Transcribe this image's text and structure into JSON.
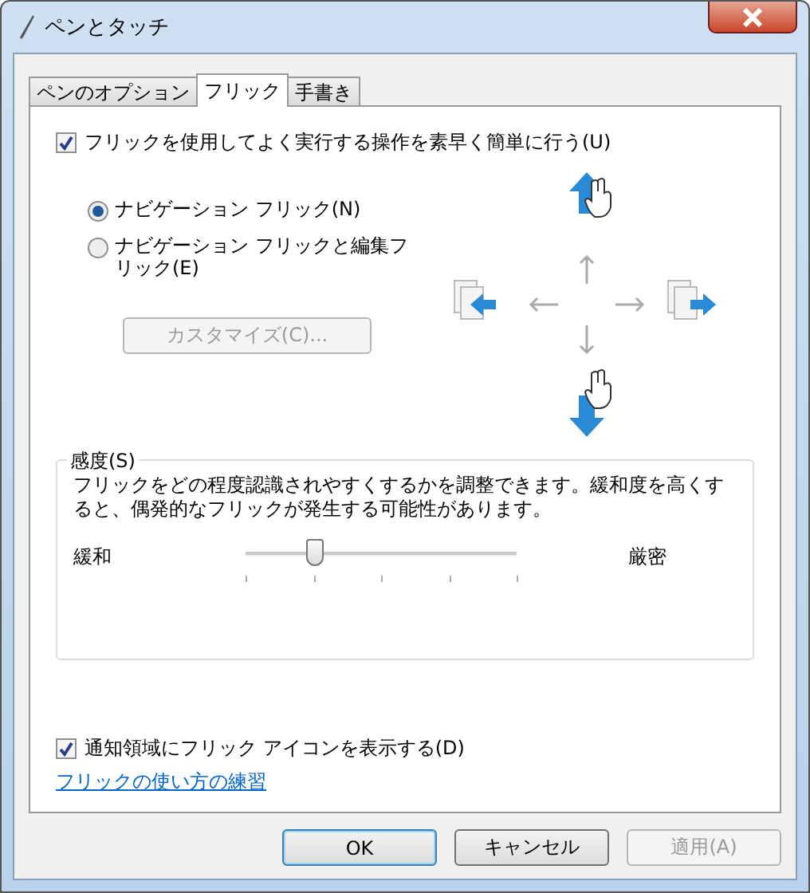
{
  "window": {
    "title": "ペンとタッチ"
  },
  "tabs": [
    {
      "label": "ペンのオプション",
      "selected": false
    },
    {
      "label": "フリック",
      "selected": true
    },
    {
      "label": "手書き",
      "selected": false
    }
  ],
  "flicks_checkbox": {
    "label": "フリックを使用してよく実行する操作を素早く簡単に行う(U)",
    "checked": true
  },
  "modes": [
    {
      "label": "ナビゲーション フリック(N)",
      "selected": true
    },
    {
      "label": "ナビゲーション フリックと編集フリック(E)",
      "selected": false
    }
  ],
  "customize_button": {
    "label": "カスタマイズ(C)...",
    "disabled": true
  },
  "sensitivity": {
    "title": "感度(S)",
    "description": "フリックをどの程度認識されやすくするかを調整できます。緩和度を高くすると、偶発的なフリックが発生する可能性があります。",
    "min_label": "緩和",
    "max_label": "厳密",
    "level": 0.25
  },
  "tray_checkbox": {
    "label": "通知領域にフリック アイコンを表示する(D)",
    "checked": true
  },
  "practice_link": "フリックの使い方の練習",
  "buttons": [
    {
      "label": "OK",
      "kind": "default",
      "disabled": false
    },
    {
      "label": "キャンセル",
      "kind": "normal",
      "disabled": false
    },
    {
      "label": "適用(A)",
      "kind": "normal",
      "disabled": true
    }
  ]
}
